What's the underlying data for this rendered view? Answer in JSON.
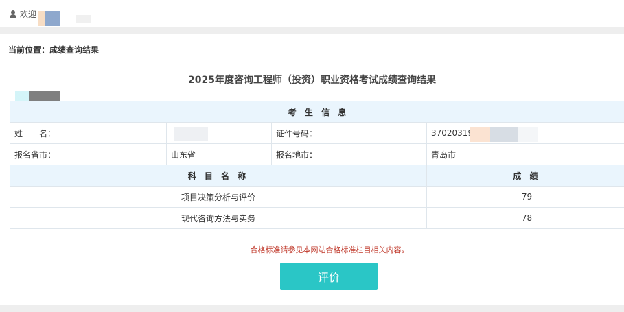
{
  "header": {
    "welcome": "欢迎"
  },
  "breadcrumb": {
    "text": "当前位置：成绩查询结果"
  },
  "page": {
    "title": "2025年度咨询工程师（投资）职业资格考试成绩查询结果"
  },
  "candidate": {
    "section_title": "考 生 信 息",
    "name_label": "姓　　名：",
    "name_value": "",
    "id_label": "证件号码：",
    "id_value": "37020319",
    "province_label": "报名省市：",
    "province_value": "山东省",
    "city_label": "报名地市：",
    "city_value": "青岛市"
  },
  "scores": {
    "subject_header": "科 目 名 称",
    "score_header": "成 绩",
    "rows": [
      {
        "subject": "项目决策分析与评价",
        "score": "79"
      },
      {
        "subject": "现代咨询方法与实务",
        "score": "78"
      }
    ]
  },
  "note": "合格标准请参见本网站合格标准栏目相关内容。",
  "buttons": {
    "evaluate": "评价"
  },
  "colors": {
    "accent": "#2ac6c6",
    "note": "#c0392b",
    "section_bg": "#eaf5fd"
  },
  "icons": {
    "user": "user-icon"
  }
}
